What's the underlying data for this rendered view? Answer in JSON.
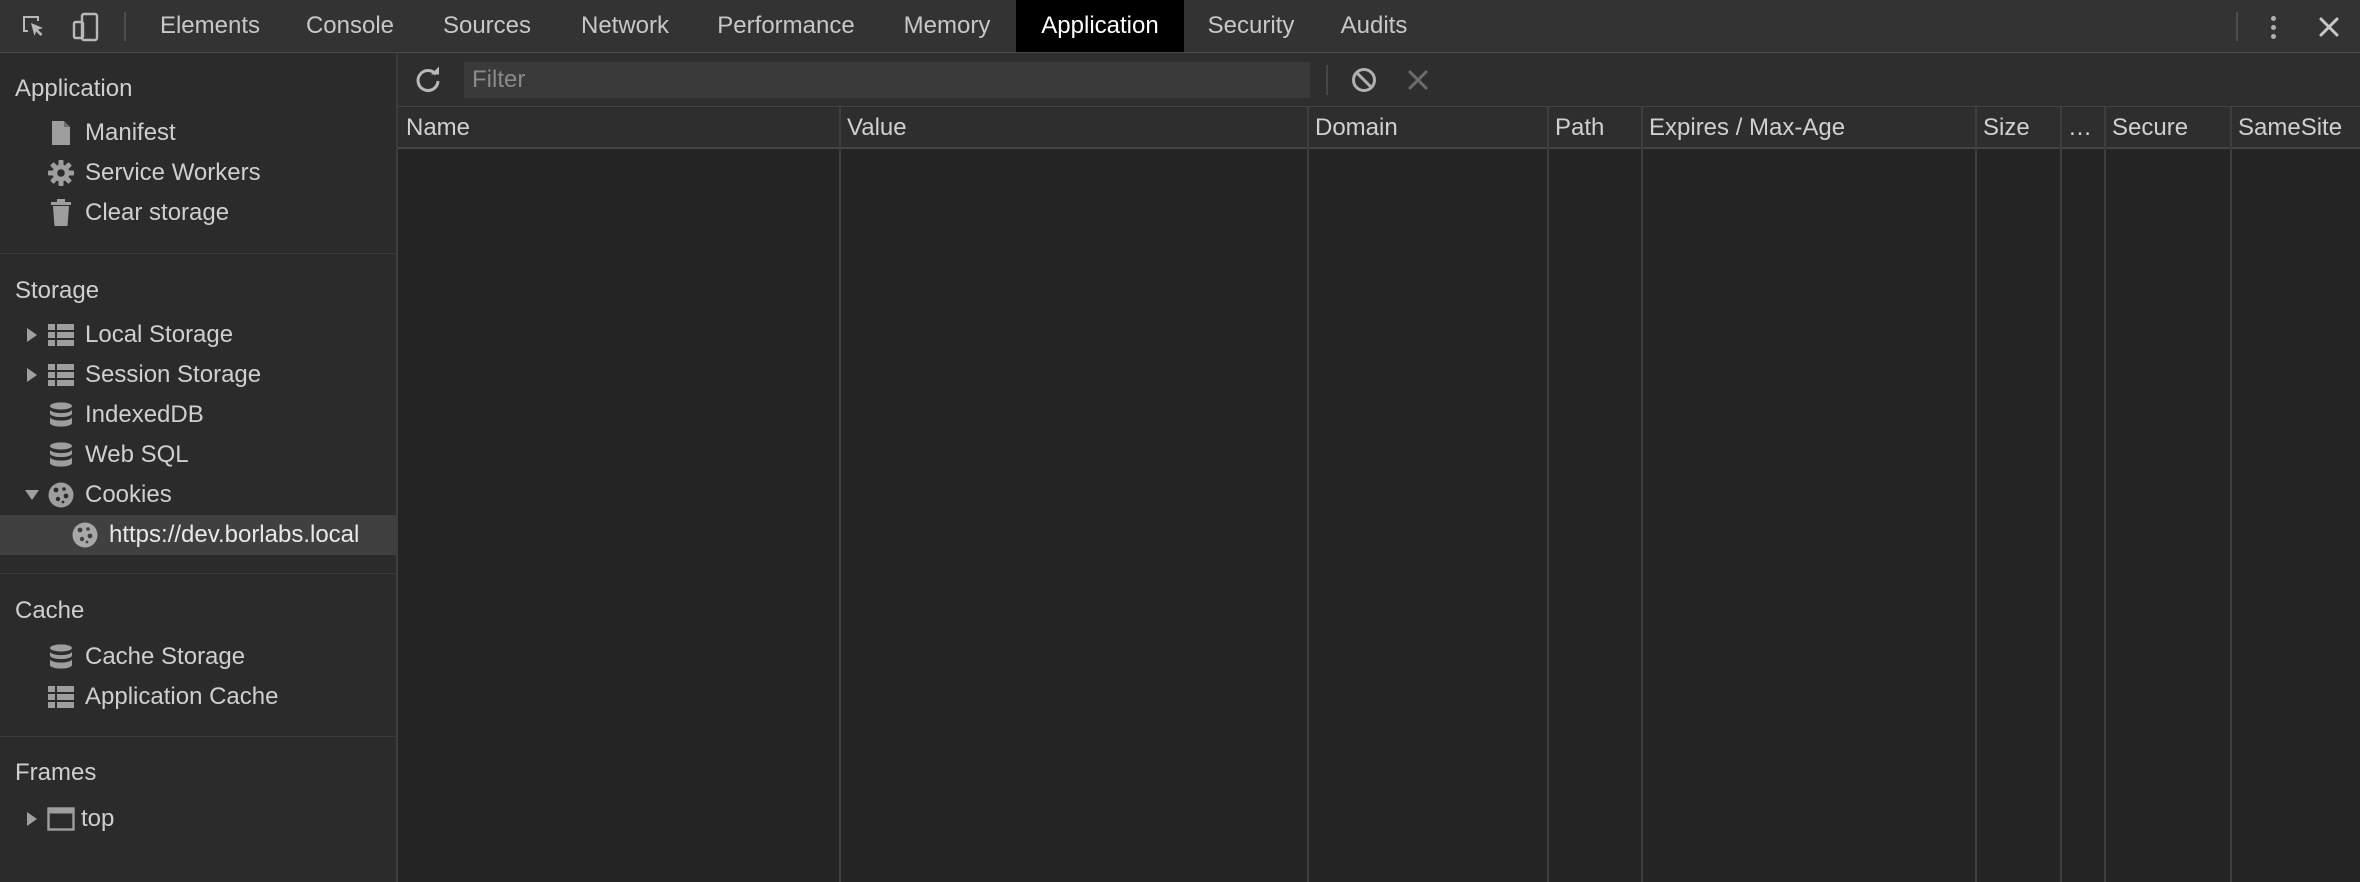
{
  "tabs": [
    {
      "label": "Elements",
      "active": false
    },
    {
      "label": "Console",
      "active": false
    },
    {
      "label": "Sources",
      "active": false
    },
    {
      "label": "Network",
      "active": false
    },
    {
      "label": "Performance",
      "active": false
    },
    {
      "label": "Memory",
      "active": false
    },
    {
      "label": "Application",
      "active": true
    },
    {
      "label": "Security",
      "active": false
    },
    {
      "label": "Audits",
      "active": false
    }
  ],
  "sidebar": {
    "application": {
      "title": "Application",
      "items": [
        {
          "label": "Manifest",
          "icon": "document-icon"
        },
        {
          "label": "Service Workers",
          "icon": "gear-icon"
        },
        {
          "label": "Clear storage",
          "icon": "trash-icon"
        }
      ]
    },
    "storage": {
      "title": "Storage",
      "items": [
        {
          "label": "Local Storage",
          "icon": "table-icon",
          "expander": "collapsed"
        },
        {
          "label": "Session Storage",
          "icon": "table-icon",
          "expander": "collapsed"
        },
        {
          "label": "IndexedDB",
          "icon": "database-icon"
        },
        {
          "label": "Web SQL",
          "icon": "database-icon"
        },
        {
          "label": "Cookies",
          "icon": "cookie-icon",
          "expander": "expanded"
        },
        {
          "label": "https://dev.borlabs.local",
          "icon": "cookie-icon",
          "selected": true
        }
      ]
    },
    "cache": {
      "title": "Cache",
      "items": [
        {
          "label": "Cache Storage",
          "icon": "database-icon"
        },
        {
          "label": "Application Cache",
          "icon": "table-icon"
        }
      ]
    },
    "frames": {
      "title": "Frames",
      "items": [
        {
          "label": "top",
          "icon": "frame-icon",
          "expander": "collapsed"
        }
      ]
    }
  },
  "toolbar": {
    "filter_placeholder": "Filter",
    "filter_value": ""
  },
  "table": {
    "columns": [
      "Name",
      "Value",
      "Domain",
      "Path",
      "Expires / Max-Age",
      "Size",
      "…",
      "Secure",
      "SameSite"
    ],
    "rows": []
  },
  "colors": {
    "active_tab_bg": "#000000",
    "panel_bg": "#242424",
    "sidebar_bg": "#2b2b2b",
    "selected_item_bg": "#404040"
  }
}
